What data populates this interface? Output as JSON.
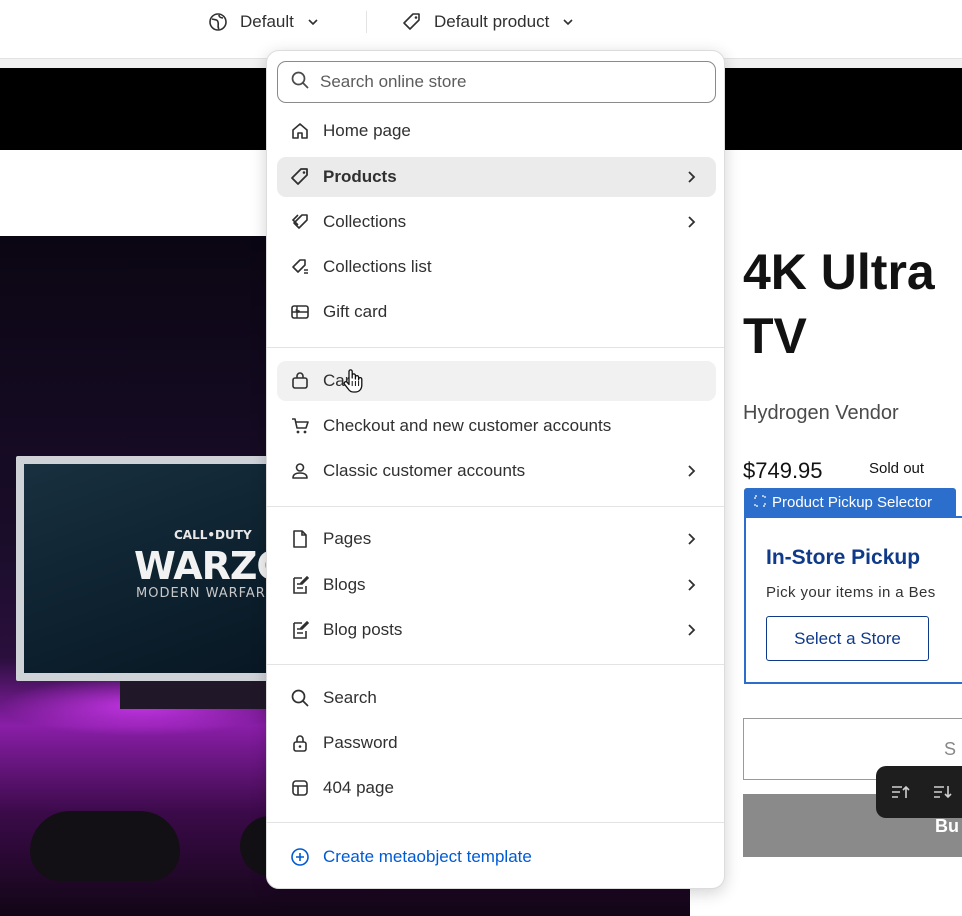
{
  "topbar": {
    "theme_label": "Default",
    "template_label": "Default product"
  },
  "dropdown": {
    "search_placeholder": "Search online store",
    "group1": [
      {
        "label": "Home page",
        "icon": "home-icon",
        "has_submenu": false
      },
      {
        "label": "Products",
        "icon": "tag-icon",
        "has_submenu": true,
        "active": true
      },
      {
        "label": "Collections",
        "icon": "collection-icon",
        "has_submenu": true
      },
      {
        "label": "Collections list",
        "icon": "collections-list-icon",
        "has_submenu": false
      },
      {
        "label": "Gift card",
        "icon": "gift-card-icon",
        "has_submenu": false
      }
    ],
    "group2": [
      {
        "label": "Cart",
        "icon": "bag-icon",
        "has_submenu": false,
        "hover": true
      },
      {
        "label": "Checkout and new customer accounts",
        "icon": "cart-icon",
        "has_submenu": false
      },
      {
        "label": "Classic customer accounts",
        "icon": "person-icon",
        "has_submenu": true
      }
    ],
    "group3": [
      {
        "label": "Pages",
        "icon": "page-icon",
        "has_submenu": true
      },
      {
        "label": "Blogs",
        "icon": "blog-icon",
        "has_submenu": true
      },
      {
        "label": "Blog posts",
        "icon": "blog-post-icon",
        "has_submenu": true
      }
    ],
    "group4": [
      {
        "label": "Search",
        "icon": "search-icon",
        "has_submenu": false
      },
      {
        "label": "Password",
        "icon": "lock-icon",
        "has_submenu": false
      },
      {
        "label": "404 page",
        "icon": "404-icon",
        "has_submenu": false
      }
    ],
    "create_label": "Create metaobject template"
  },
  "product": {
    "title_line1": "4K Ultra",
    "title_line2": "TV",
    "vendor": "Hydrogen Vendor",
    "price": "$749.95",
    "status": "Sold out",
    "buy_partial": "Bu",
    "qty_partial": "S"
  },
  "pickup": {
    "tag_label": "Product Pickup Selector",
    "title": "In-Store Pickup",
    "description": "Pick your items in a Bes",
    "button_label": "Select a Store"
  },
  "hero_text": {
    "cod": "CALL•DUTY",
    "warzone": "WARZONE",
    "modern": "MODERN WARFARE"
  },
  "colors": {
    "accent_blue": "#2c6ecb",
    "link_blue": "#005bd3",
    "pickup_navy": "#0f3a8a"
  }
}
